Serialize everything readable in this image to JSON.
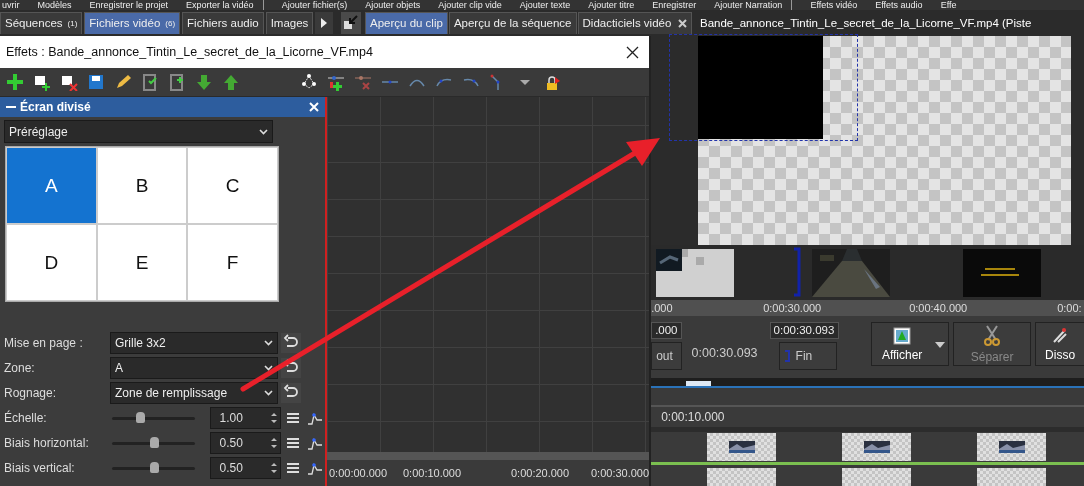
{
  "menu": [
    {
      "label": "uvrir",
      "sep": false
    },
    {
      "label": "Modèles",
      "sep": false
    },
    {
      "label": "Enregistrer le projet",
      "sep": false
    },
    {
      "label": "Exporter la vidéo",
      "sep": true
    },
    {
      "label": "Ajouter fichier(s)",
      "sep": false
    },
    {
      "label": "Ajouter objets",
      "sep": false
    },
    {
      "label": "Ajouter clip vide",
      "sep": false
    },
    {
      "label": "Ajouter texte",
      "sep": false
    },
    {
      "label": "Ajouter titre",
      "sep": false
    },
    {
      "label": "Enregistrer",
      "sep": false
    },
    {
      "label": "Ajouter Narration",
      "sep": true
    },
    {
      "label": "Effets vidéo",
      "sep": false
    },
    {
      "label": "Effets audio",
      "sep": false
    },
    {
      "label": "Effe",
      "sep": false
    }
  ],
  "library_tabs": [
    {
      "label": "Séquences",
      "count": "(1)",
      "selected": false
    },
    {
      "label": "Fichiers vidéo",
      "count": "(6)",
      "selected": true
    },
    {
      "label": "Fichiers audio",
      "selected": false
    },
    {
      "label": "Images",
      "selected": false
    }
  ],
  "preview_tabs": [
    {
      "label": "Aperçu du clip",
      "selected": true,
      "closable": false
    },
    {
      "label": "Aperçu de la séquence",
      "selected": false,
      "closable": false
    },
    {
      "label": "Didacticiels vidéo",
      "selected": false,
      "closable": true
    }
  ],
  "clip_title": "Bande_annonce_Tintin_Le_secret_de_la_Licorne_VF.mp4 (Piste",
  "effects_dialog": {
    "title": "Effets : Bande_annonce_Tintin_Le_secret_de_la_Licorne_VF.mp4",
    "effect_name": "Écran divisé",
    "preset": "Préréglage",
    "zones": [
      {
        "label": "A",
        "selected": true
      },
      {
        "label": "B",
        "selected": false
      },
      {
        "label": "C",
        "selected": false
      },
      {
        "label": "D",
        "selected": false
      },
      {
        "label": "E",
        "selected": false
      },
      {
        "label": "F",
        "selected": false
      }
    ],
    "settings": [
      {
        "kind": "dropdown",
        "label": "Mise en page :",
        "value": "Grille 3x2"
      },
      {
        "kind": "dropdown",
        "label": "Zone:",
        "value": "A"
      },
      {
        "kind": "dropdown",
        "label": "Rognage:",
        "value": "Zone de remplissage"
      },
      {
        "kind": "slider",
        "label": "Échelle:",
        "value": "1.00",
        "level": 0.33
      },
      {
        "kind": "slider",
        "label": "Biais horizontal:",
        "value": "0.50",
        "level": 0.5
      },
      {
        "kind": "slider",
        "label": "Biais vertical:",
        "value": "0.50",
        "level": 0.5
      }
    ],
    "ruler": [
      "0:00:00.000",
      "0:00:10.000",
      "0:00:20.000",
      "0:00:30.000"
    ]
  },
  "preview": {
    "ruler": [
      ".000",
      "0:00:30.000",
      "0:00:40.000",
      "0:00:"
    ],
    "start": ".000",
    "end": "0:00:30.093",
    "duration": "0:00:30.093",
    "start_button": "out",
    "end_button": "Fin",
    "actions": [
      {
        "kind": "show",
        "label": "Afficher",
        "disabled": false
      },
      {
        "kind": "split",
        "label": "Séparer",
        "disabled": true
      },
      {
        "kind": "dissolve",
        "label": "Disso",
        "disabled": false
      }
    ]
  },
  "timeline": {
    "ruler": "0:00:10.000"
  }
}
